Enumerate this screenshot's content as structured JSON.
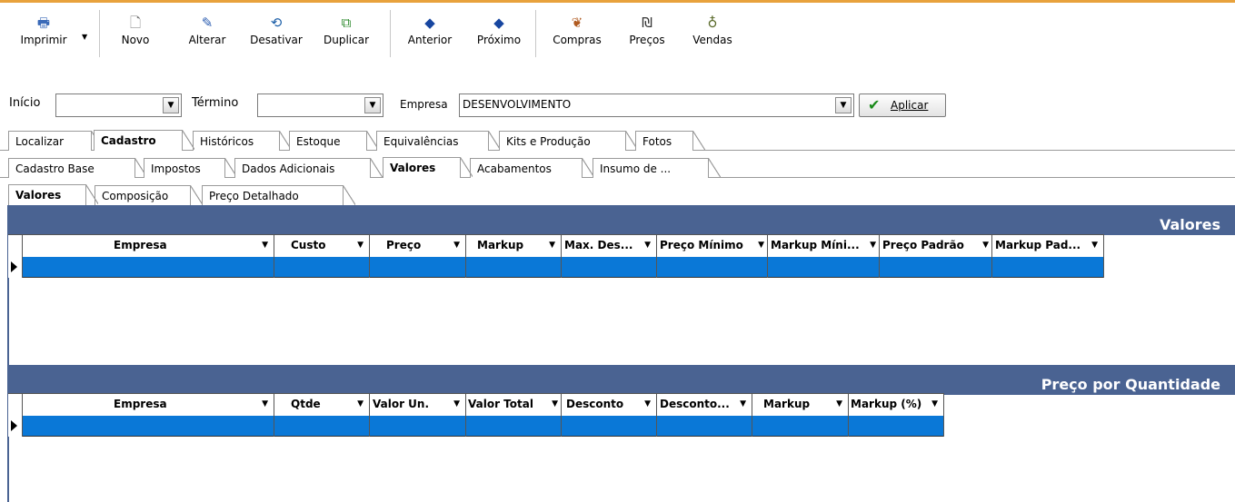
{
  "toolbar": {
    "buttons": [
      {
        "label": "Imprimir",
        "icon": "printer-icon"
      },
      {
        "label": "Novo",
        "icon": "new-document-icon"
      },
      {
        "label": "Alterar",
        "icon": "edit-pencil-icon"
      },
      {
        "label": "Desativar",
        "icon": "deactivate-icon"
      },
      {
        "label": "Duplicar",
        "icon": "duplicate-icon"
      },
      {
        "label": "Anterior",
        "icon": "arrow-left-icon"
      },
      {
        "label": "Próximo",
        "icon": "arrow-right-icon"
      },
      {
        "label": "Compras",
        "icon": "purchases-icon"
      },
      {
        "label": "Preços",
        "icon": "prices-icon"
      },
      {
        "label": "Vendas",
        "icon": "sales-icon"
      }
    ]
  },
  "filter": {
    "inicio_label": "Início",
    "termino_label": "Término",
    "empresa_label": "Empresa",
    "empresa_value": "DESENVOLVIMENTO",
    "apply_label": "Aplicar"
  },
  "tabs_main": [
    "Localizar",
    "Cadastro",
    "Históricos",
    "Estoque",
    "Equivalências",
    "Kits e Produção",
    "Fotos"
  ],
  "tabs_cadastro": [
    "Cadastro Base",
    "Impostos",
    "Dados Adicionais",
    "Valores",
    "Acabamentos",
    "Insumo de ..."
  ],
  "tabs_valores": [
    "Valores",
    "Composição",
    "Preço Detalhado"
  ],
  "grid_valores": {
    "title": "Valores",
    "columns": [
      "Empresa",
      "Custo",
      "Preço",
      "Markup",
      "Max. Des...",
      "Preço Mínimo",
      "Markup Míni...",
      "Preço Padrão",
      "Markup Pad..."
    ]
  },
  "grid_qtd": {
    "title": "Preço por Quantidade",
    "columns": [
      "Empresa",
      "Qtde",
      "Valor Un.",
      "Valor Total",
      "Desconto",
      "Desconto...",
      "Markup",
      "Markup (%)"
    ]
  },
  "colors": {
    "header_bar": "#4a6392",
    "selected_row": "#0a78d7",
    "top_line": "#e8a23c"
  }
}
